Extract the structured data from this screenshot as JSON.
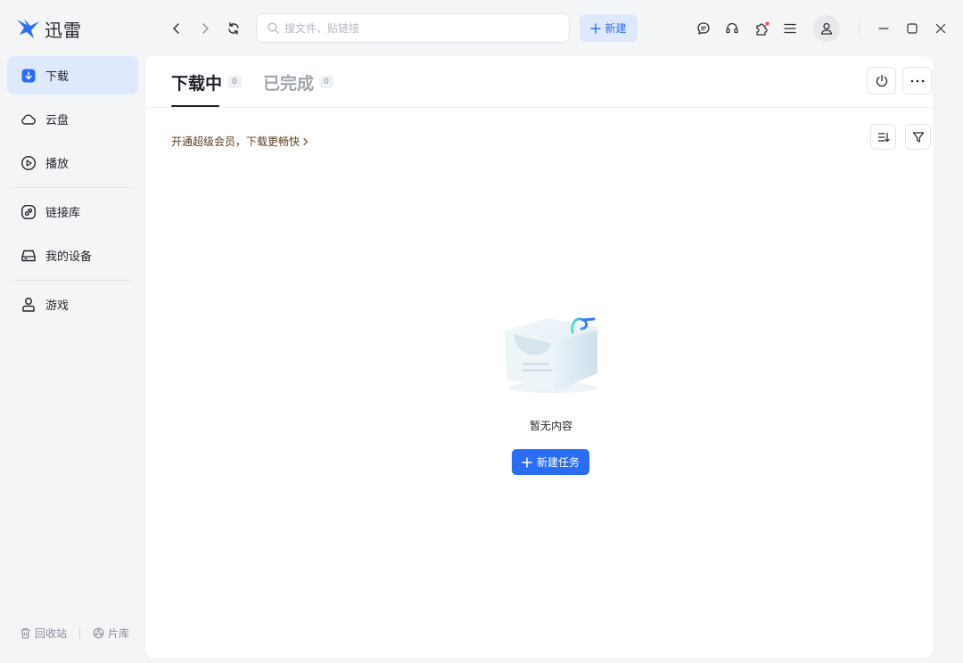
{
  "app": {
    "name": "迅雷"
  },
  "search": {
    "placeholder": "搜文件、贴链接",
    "value": ""
  },
  "toolbar": {
    "new_label": "新建"
  },
  "sidebar": {
    "items": [
      {
        "label": "下载",
        "icon": "download-icon",
        "active": true
      },
      {
        "label": "云盘",
        "icon": "cloud-icon"
      },
      {
        "label": "播放",
        "icon": "play-icon"
      },
      {
        "label": "链接库",
        "icon": "link-icon"
      },
      {
        "label": "我的设备",
        "icon": "device-icon"
      },
      {
        "label": "游戏",
        "icon": "game-icon"
      }
    ],
    "footer": {
      "recycle_label": "回收站",
      "library_label": "片库"
    }
  },
  "tabs": [
    {
      "label": "下载中",
      "count": "0",
      "active": true
    },
    {
      "label": "已完成",
      "count": "0"
    }
  ],
  "promo": {
    "text": "开通超级会员，下载更畅快"
  },
  "empty": {
    "text": "暂无内容",
    "button_label": "新建任务"
  },
  "colors": {
    "accent": "#2a6df4",
    "accent_light": "#dfe9fd",
    "promo_text": "#5a3f22"
  }
}
